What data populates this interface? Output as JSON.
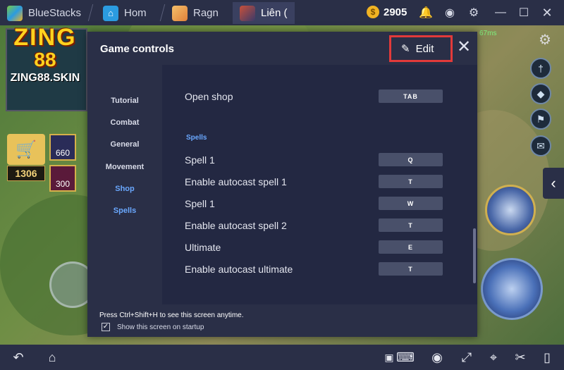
{
  "titlebar": {
    "tabs": [
      {
        "label": "BlueStacks",
        "icon": "bluestacks-logo-icon"
      },
      {
        "label": "Hom",
        "icon": "home-icon"
      },
      {
        "label": "Ragn",
        "icon": "ragnarok-app-icon"
      },
      {
        "label": "Liên (",
        "icon": "lien-quan-app-icon"
      }
    ],
    "coins": "2905",
    "icons": [
      "bell-icon",
      "profile-icon",
      "gear-icon",
      "minimize-icon",
      "maximize-icon",
      "close-icon"
    ]
  },
  "game": {
    "gold": "1306",
    "items": [
      "660",
      "300"
    ],
    "ping": "67ms",
    "logo": {
      "line1": "ZING",
      "line2": "88",
      "url": "ZING88.SKIN"
    }
  },
  "dialog": {
    "title": "Game controls",
    "edit_label": "Edit",
    "nav": [
      {
        "label": "Tutorial",
        "active": false
      },
      {
        "label": "Combat",
        "active": false
      },
      {
        "label": "General",
        "active": false
      },
      {
        "label": "Movement",
        "active": false
      },
      {
        "label": "Shop",
        "active": true
      },
      {
        "label": "Spells",
        "active": true
      }
    ],
    "shop_row": {
      "label": "Open shop",
      "key": "TAB"
    },
    "spells_section": "Spells",
    "spell_rows": [
      {
        "label": "Spell 1",
        "key": "Q"
      },
      {
        "label": "Enable autocast spell 1",
        "key": "T"
      },
      {
        "label": "Spell 1",
        "key": "W"
      },
      {
        "label": "Enable autocast spell 2",
        "key": "T"
      },
      {
        "label": "Ultimate",
        "key": "E"
      },
      {
        "label": "Enable autocast ultimate",
        "key": "T"
      }
    ],
    "footer_text": "Press Ctrl+Shift+H to see this screen anytime.",
    "checkbox_label": "Show this screen on startup",
    "checkbox_checked": true
  },
  "bottombar": {
    "icons": [
      "back-icon",
      "home-shape-icon",
      "keyboard-icon",
      "eye-icon",
      "fullscreen-icon",
      "location-icon",
      "scissors-icon",
      "phone-rotate-icon"
    ]
  },
  "colors": {
    "panel": "#2a2f47",
    "content": "#232842",
    "accent_blue": "#6aa8ff",
    "highlight_red": "#e23a3a"
  }
}
